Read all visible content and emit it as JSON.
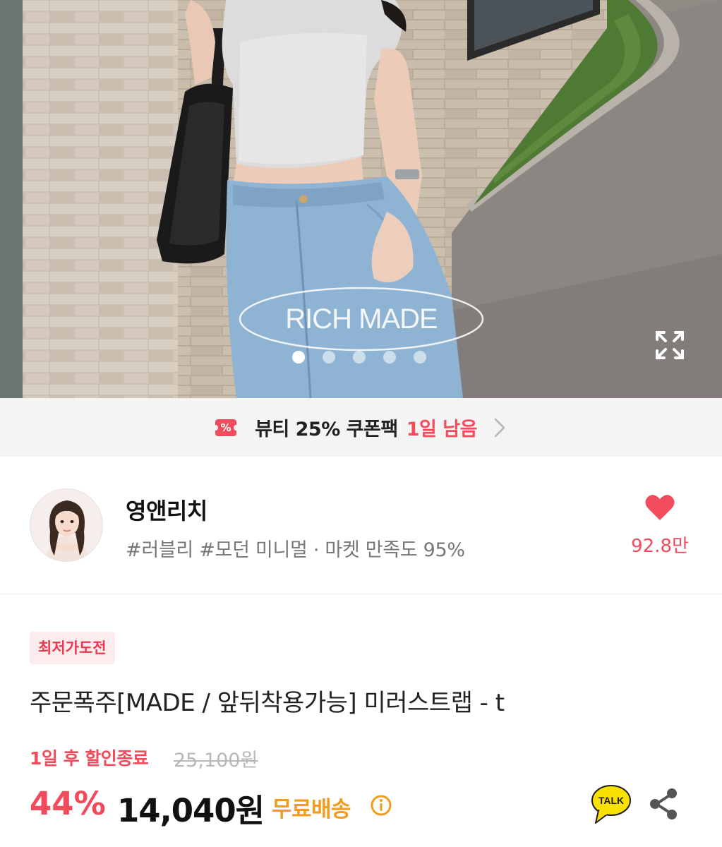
{
  "hero": {
    "watermark": "RICH MADE",
    "slide_count": 5,
    "active_slide": 1,
    "icons": {
      "expand": "expand-icon"
    }
  },
  "coupon": {
    "icon": "coupon-icon",
    "text": "뷰티 25% 쿠폰팩",
    "remaining": "1일 남음",
    "chevron": "chevron-right-icon"
  },
  "seller": {
    "name": "영앤리치",
    "tags": "#러블리 #모던 미니멀 · 마켓 만족도 95%",
    "like_count": "92.8만",
    "icons": {
      "like": "heart-icon"
    }
  },
  "product": {
    "badge": "최저가도전",
    "title": "주문폭주[MADE / 앞뒤착용가능] 미러스트랩 - t",
    "sale_end": "1일 후 할인종료",
    "original_price": "25,100원",
    "discount_rate": "44%",
    "price": "14,040원",
    "shipping": "무료배송",
    "talk_label": "TALK",
    "icons": {
      "info": "info-icon",
      "talk": "kakao-talk-icon",
      "share": "share-icon"
    }
  },
  "colors": {
    "accent": "#f24b5b",
    "shipping": "#f29c1f",
    "talk": "#fae100"
  }
}
